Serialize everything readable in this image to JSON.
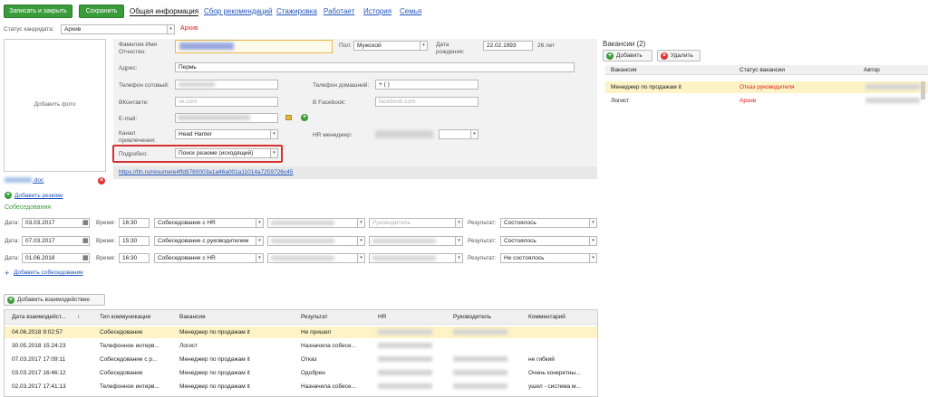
{
  "toolbar": {
    "save_close": "Записать и закрыть",
    "save": "Сохранить"
  },
  "tabs": [
    "Общая информация",
    "Сбор рекомендаций",
    "Стажировка",
    "Работает",
    "История",
    "Семья"
  ],
  "status": {
    "label": "Статус кандидата:",
    "value": "Архив",
    "tag": "Архив"
  },
  "photo": {
    "label": "Добавить фото"
  },
  "form": {
    "fio_label": "Фамилия Имя Отчество:",
    "sex_label": "Пол:",
    "sex_value": "Мужской",
    "birth_label": "Дата рождения:",
    "birth_value": "22.02.1993",
    "age": "26 лет",
    "address_label": "Адрес:",
    "address_value": "Пермь",
    "mobile_label": "Телефон сотовый:",
    "home_phone_label": "Телефон домашний:",
    "home_phone_value": "+  (   )",
    "vk_label": "ВКонтакте:",
    "vk_placeholder": "vk.com",
    "fb_label": "В Facebook:",
    "fb_placeholder": "facebook.com",
    "email_label": "E-mail:",
    "channel_label": "Канал привлечения:",
    "channel_value": "Head Hanter",
    "hr_manager_label": "HR менеджер:",
    "detail_label": "Подробно:",
    "detail_value": "Поиск резюме (исходящий)",
    "resume_link": "https://hh.ru/resume/e4ffd9780003a1a46a001a11014a7259726c45"
  },
  "resume": {
    "file": ".doc",
    "add": "Добавить резюме"
  },
  "interviews": {
    "title": "Собеседования",
    "date_label": "Дата:",
    "time_label": "Время:",
    "result_label": "Результат:",
    "manager_placeholder": "Руководитель",
    "rows": [
      {
        "date": "03.03.2017",
        "time": "16:30",
        "type": "Собеседование с HR",
        "result": "Состоялось"
      },
      {
        "date": "07.03.2017",
        "time": "15:30",
        "type": "Собеседование с руководителем",
        "result": "Состоялось"
      },
      {
        "date": "01.06.2018",
        "time": "16:30",
        "type": "Собеседование с HR",
        "result": "Не состоялось"
      }
    ],
    "add": "Добавить собеседование"
  },
  "vacancies": {
    "title": "Вакансии (2)",
    "add": "Добавить",
    "delete": "Удалить",
    "headers": [
      "Вакансия",
      "Статус вакансии",
      "Автор"
    ],
    "rows": [
      {
        "name": "Менеджер по продажам it",
        "status": "Отказ руководителя"
      },
      {
        "name": "Логист",
        "status": "Архив"
      }
    ]
  },
  "interactions": {
    "add": "Добавить взаимодействие",
    "headers": [
      "Дата взаимодейст...",
      "Тип коммуникации",
      "Вакансия",
      "Результат",
      "HR",
      "Руководитель",
      "Комментарий"
    ],
    "rows": [
      {
        "date": "04.06.2018 9:02:57",
        "type": "Собеседование",
        "vac": "Менеджер по продажам it",
        "res": "Не пришел",
        "comment": ""
      },
      {
        "date": "30.05.2018 15:24:23",
        "type": "Телефонное интерв...",
        "vac": "Логист",
        "res": "Назначила собесе...",
        "comment": ""
      },
      {
        "date": "07.03.2017 17:09:11",
        "type": "Собеседование с р...",
        "vac": "Менеджер по продажам it",
        "res": "Отказ",
        "comment": "не гибкий"
      },
      {
        "date": "03.03.2017 16:46:12",
        "type": "Собеседование",
        "vac": "Менеджер по продажам it",
        "res": "Одобрен",
        "comment": "Очень конкретны..."
      },
      {
        "date": "02.03.2017 17:41:13",
        "type": "Телефонное интерв...",
        "vac": "Менеджер по продажам it",
        "res": "Назначила собесе...",
        "comment": "ушел - система м..."
      }
    ]
  }
}
